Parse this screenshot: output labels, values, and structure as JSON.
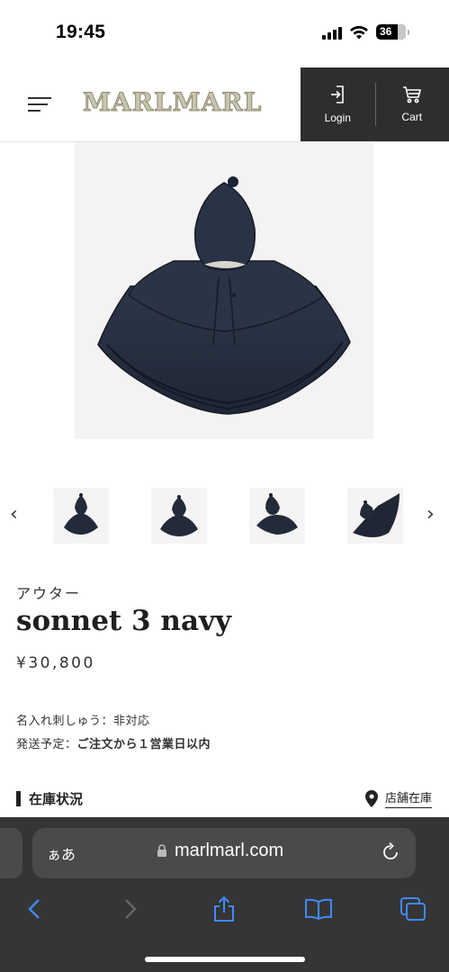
{
  "status_bar": {
    "time": "19:45",
    "battery": "36",
    "icons": [
      "signal-icon",
      "wifi-icon",
      "battery-icon"
    ]
  },
  "header": {
    "logo": "MARLMARL",
    "login_label": "Login",
    "cart_label": "Cart",
    "icons": [
      "menu-icon",
      "login-icon",
      "cart-icon"
    ]
  },
  "product": {
    "category": "アウター",
    "name": "sonnet 3 navy",
    "price": "¥30,800",
    "embroidery_label": "名入れ刺しゅう：",
    "embroidery_value": "非対応",
    "shipping_label": "発送予定：",
    "shipping_value": "ご注文から１営業日以内",
    "stock_title": "在庫状況",
    "store_link": "店舗在庫"
  },
  "colors": {
    "header_dark": "#2e2e2e",
    "garment_navy": "#27303f",
    "safari_bg": "#353535",
    "safari_accent": "#3d8bfd"
  },
  "browser": {
    "aa_label": "ぁあ",
    "url": "marlmarl.com",
    "icons": [
      "lock-icon",
      "reload-icon",
      "back-icon",
      "forward-icon",
      "share-icon",
      "bookmarks-icon",
      "tabs-icon"
    ]
  }
}
